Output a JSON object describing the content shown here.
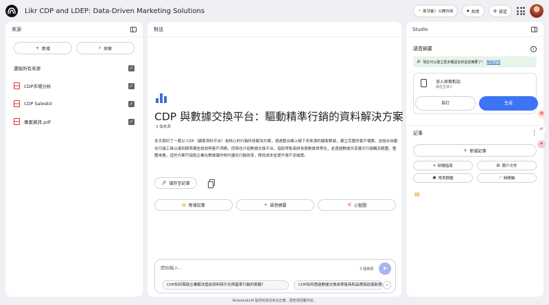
{
  "app": {
    "title": "Likr CDP and LDEP: Data-Driven Marketing Solutions",
    "new_feature": "新功能！公開共用",
    "share": "共用",
    "settings": "設定"
  },
  "sources": {
    "header": "來源",
    "add": "新增",
    "explore": "探索",
    "select_all": "選取所有來源",
    "items": [
      {
        "name": "CDP市場分析"
      },
      {
        "name": "CDP Saleskit"
      },
      {
        "name": "專案資訊.pdf"
      }
    ]
  },
  "chat": {
    "header": "對話",
    "title": "CDP 與數據交換平台：驅動精準行銷的資料解決方案",
    "source_count": "3 個來源",
    "summary": "本文探討了一套以 CDP（顧客資料平台）為核心的行銷科技解決方案，透過整合線上線下多來源的顧客數據，建立完整的客戶檔案，並結合自動化行銷工具以達到精準廣告投放與客戶洞察。同時也介紹數據交換平台，協助零售商將會員數據貨幣化，並透過數據共享擴大行銷觸及範圍，整體來看，這些方案可協助企業在數據爆炸時代優化行銷效率，降低成本並提升客戶忠誠度。",
    "save_to_note": "儲存至記事",
    "actions": {
      "add_note": "新增記事",
      "audio_overview": "語音摘要",
      "mind_map": "心智圖"
    },
    "input_placeholder": "開始輸入...",
    "input_count": "3 個來源",
    "suggestions": [
      "CDP如何幫助企業解決當前資料碎片化與基準行銷的挑戰？",
      "CDP如何透過數據交換為零售商和品牌商創造新價值？"
    ]
  },
  "studio": {
    "header": "Studio",
    "audio_overview": "語音摘要",
    "promo_text": "現在可以建立更多種語言的語音摘要了！",
    "promo_link": "瞭解詳情",
    "deep_dive_title": "深入探索對話",
    "deep_dive_sub": "兩位主持人",
    "customize": "自訂",
    "generate": "生成",
    "notes_header": "記事",
    "add_note": "新增記事",
    "note_buttons": [
      "研讀指南",
      "簡介文件",
      "常見問題",
      "時間軸"
    ]
  },
  "footer": "NotebookLM 提供的資訊未必正確，請查證回覆內容。"
}
